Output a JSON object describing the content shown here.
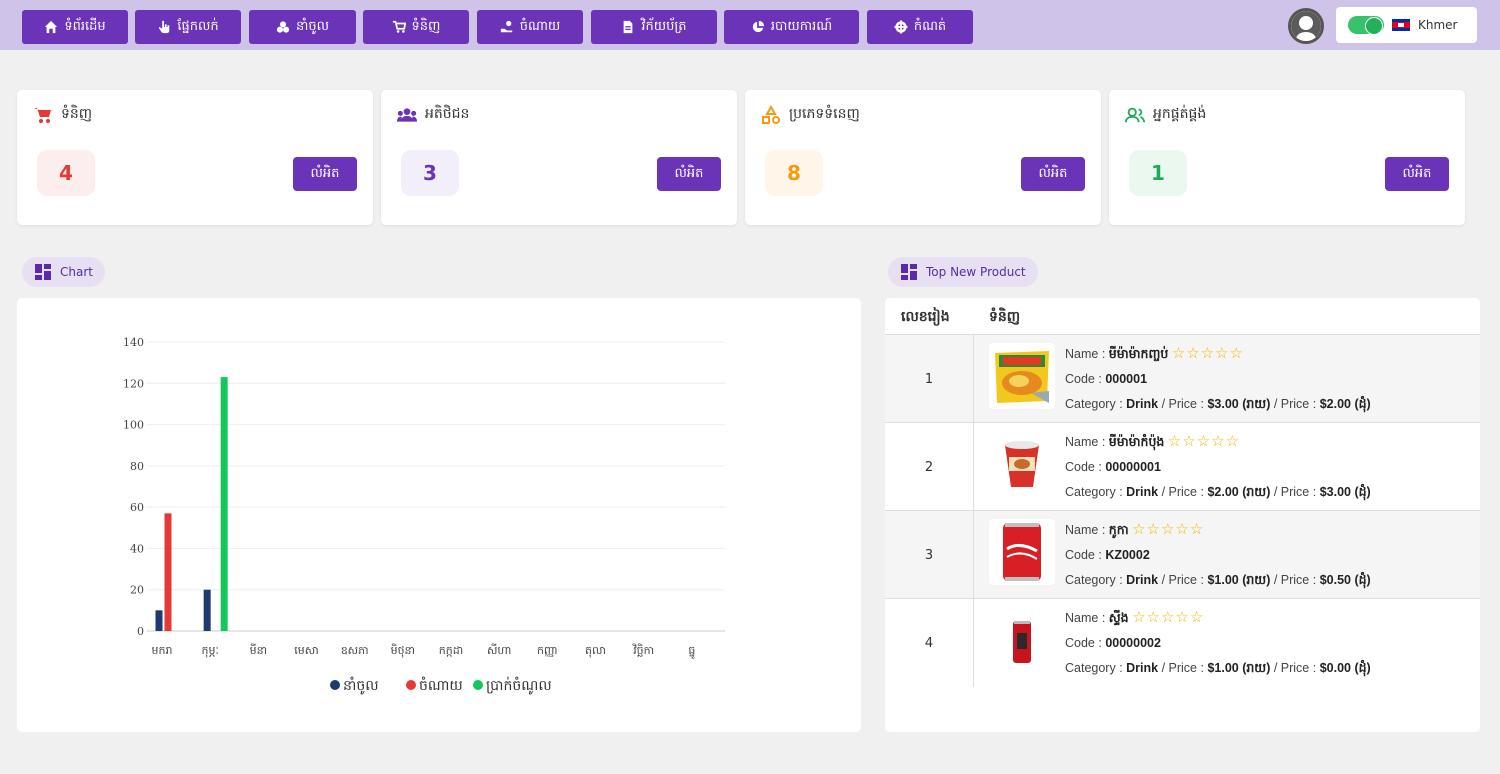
{
  "nav": {
    "items": [
      {
        "label": "ទំព័រដើម",
        "icon": "home-icon"
      },
      {
        "label": "ផ្នែកលក់",
        "icon": "hand-pointer-icon"
      },
      {
        "label": "នាំចូល",
        "icon": "cubes-icon"
      },
      {
        "label": "ទំនិញ",
        "icon": "cart-icon"
      },
      {
        "label": "ចំណាយ",
        "icon": "hand-coin-icon"
      },
      {
        "label": "វិក័យប័ត្រ",
        "icon": "file-icon"
      },
      {
        "label": "របាយការណ៍",
        "icon": "pie-chart-icon"
      },
      {
        "label": "កំណត់",
        "icon": "gear-icon"
      }
    ],
    "language": "Khmer"
  },
  "cards": [
    {
      "title": "ទំនិញ",
      "value": "4",
      "button": "លំអិត",
      "color": "#e53935",
      "bg": "#fdeeee",
      "icon": "cart-icon"
    },
    {
      "title": "អតិថិជន",
      "value": "3",
      "button": "លំអិត",
      "color": "#6a33b8",
      "bg": "#f2eefa",
      "icon": "users-icon"
    },
    {
      "title": "ប្រភេទទំនេញ",
      "value": "8",
      "button": "លំអិត",
      "color": "#f39c12",
      "bg": "#fff5e8",
      "icon": "shapes-icon"
    },
    {
      "title": "អ្នកផ្គត់ផ្គង់",
      "value": "1",
      "button": "លំអិត",
      "color": "#1faa59",
      "bg": "#eaf8ef",
      "icon": "supplier-icon"
    }
  ],
  "sections": {
    "chart_label": "Chart",
    "product_label": "Top New Product"
  },
  "chart_data": {
    "type": "bar",
    "categories": [
      "មករា",
      "កុម្ភៈ",
      "មីនា",
      "មេសា",
      "ឧសភា",
      "មិថុនា",
      "កក្កដា",
      "សីហា",
      "កញ្ញា",
      "តុលា",
      "វិច្ឆិកា",
      "ធ្នូ"
    ],
    "series": [
      {
        "name": "នាំចូល",
        "color": "#1f3a6e",
        "values": [
          10,
          20,
          0,
          0,
          0,
          0,
          0,
          0,
          0,
          0,
          0,
          0
        ]
      },
      {
        "name": "ចំណាយ",
        "color": "#e53935",
        "values": [
          57,
          0,
          0,
          0,
          0,
          0,
          0,
          0,
          0,
          0,
          0,
          0
        ]
      },
      {
        "name": "ប្រាក់ចំណូល",
        "color": "#13c75a",
        "values": [
          0,
          123,
          0,
          0,
          0,
          0,
          0,
          0,
          0,
          0,
          0,
          0
        ]
      }
    ],
    "ylim": [
      0,
      140
    ],
    "yticks": [
      0,
      20,
      40,
      60,
      80,
      100,
      120,
      140
    ],
    "grid": true,
    "legend": "bottom"
  },
  "products": {
    "headers": [
      "លេខរៀង",
      "ទំនិញ"
    ],
    "labels": {
      "name": "Name",
      "code": "Code",
      "category": "Category",
      "price": "Price"
    },
    "rows": [
      {
        "no": "1",
        "name": "មីម៉ាម៉ាកញ្ចប់",
        "code": "000001",
        "category": "Drink",
        "price1": "$3.00 (រាយ)",
        "price2": "$2.00 (ដុំ)",
        "stars": "☆☆☆☆☆"
      },
      {
        "no": "2",
        "name": "មីម៉ាម៉ាកំប៉ុង",
        "code": "00000001",
        "category": "Drink",
        "price1": "$2.00 (រាយ)",
        "price2": "$3.00 (ដុំ)",
        "stars": "☆☆☆☆☆"
      },
      {
        "no": "3",
        "name": "កូកា",
        "code": "KZ0002",
        "category": "Drink",
        "price1": "$1.00 (រាយ)",
        "price2": "$0.50 (ដុំ)",
        "stars": "☆☆☆☆☆"
      },
      {
        "no": "4",
        "name": "ស្ទីង",
        "code": "00000002",
        "category": "Drink",
        "price1": "$1.00 (រាយ)",
        "price2": "$0.00 (ដុំ)",
        "stars": "☆☆☆☆☆"
      }
    ]
  }
}
